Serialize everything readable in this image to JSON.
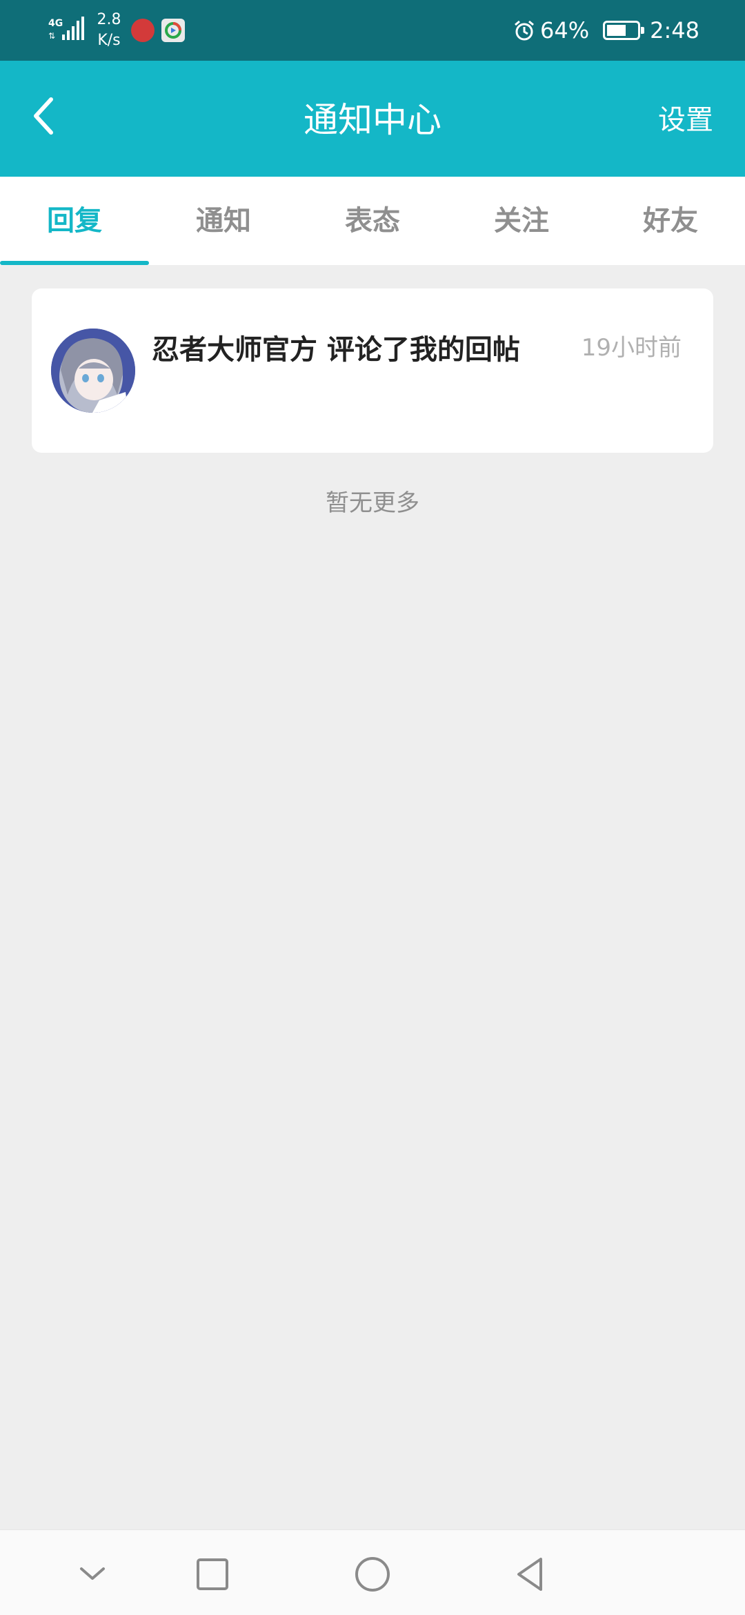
{
  "status_bar": {
    "network": "4G",
    "speed_value": "2.8",
    "speed_unit": "K/s",
    "alarm_icon": "alarm-icon",
    "battery_percent": "64%",
    "battery_level": 0.64,
    "time": "2:48"
  },
  "header": {
    "title": "通知中心",
    "settings_label": "设置",
    "background": "#14b7c7"
  },
  "tabs": [
    {
      "label": "回复",
      "active": true
    },
    {
      "label": "通知",
      "active": false
    },
    {
      "label": "表态",
      "active": false
    },
    {
      "label": "关注",
      "active": false
    },
    {
      "label": "好友",
      "active": false
    }
  ],
  "notifications": [
    {
      "message": "忍者大师官方 评论了我的回帖",
      "time": "19小时前"
    }
  ],
  "footer_text": "暂无更多",
  "colors": {
    "accent": "#14b7c7",
    "status_bar": "#0f6e78",
    "page_background": "#eeeeee"
  }
}
